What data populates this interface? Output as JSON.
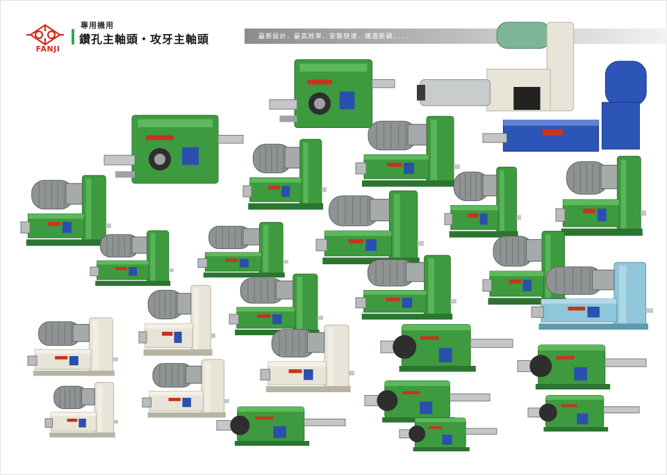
{
  "brand": {
    "logo_text": "FANJI"
  },
  "header": {
    "category": "專用機用",
    "title": "鑽孔主軸頭・攻牙主軸頭",
    "tagline": "最新設計．最高效率．安裝快速．構造新穎．．．．"
  },
  "colors": {
    "accent_green": "#2fa84f",
    "brand_red": "#d62a1e",
    "machine_green": "#3e9a3e",
    "machine_cream": "#e8e5d8",
    "machine_blue": "#2d55b8",
    "machine_lightblue": "#8fc6da",
    "motor_gray": "#8f9393"
  },
  "icons": {
    "logo": "fanji-logo-icon"
  },
  "products": [
    {
      "name": "twin-spindle-gearbox-head-large",
      "body": "green"
    },
    {
      "name": "twin-spindle-gearbox-head-top",
      "body": "green"
    },
    {
      "name": "servo-spindle-head",
      "body": "cream"
    },
    {
      "name": "blue-geared-feed-unit",
      "body": "blue"
    },
    {
      "name": "motor-drilling-head-left",
      "body": "green"
    },
    {
      "name": "motor-drilling-head-center-upper",
      "body": "green"
    },
    {
      "name": "motor-drilling-head-upper-right",
      "body": "green"
    },
    {
      "name": "motor-drilling-head-right-1",
      "body": "green"
    },
    {
      "name": "motor-drilling-head-right-2",
      "body": "green"
    },
    {
      "name": "motor-drilling-head-small-1",
      "body": "green"
    },
    {
      "name": "motor-drilling-head-mid-1",
      "body": "green"
    },
    {
      "name": "motor-drilling-head-mid-2",
      "body": "green"
    },
    {
      "name": "motor-drilling-head-mid-3",
      "body": "green"
    },
    {
      "name": "motor-drilling-head-mid-4",
      "body": "green"
    },
    {
      "name": "motor-drilling-head-right-3",
      "body": "green"
    },
    {
      "name": "lightblue-drilling-head",
      "body": "lightblue"
    },
    {
      "name": "cream-drilling-head-1",
      "body": "cream"
    },
    {
      "name": "cream-drilling-head-2",
      "body": "cream"
    },
    {
      "name": "cream-drilling-head-3",
      "body": "cream"
    },
    {
      "name": "cream-drilling-head-4",
      "body": "cream"
    },
    {
      "name": "cream-drilling-head-5",
      "body": "cream"
    },
    {
      "name": "green-spindle-unit-1",
      "body": "green"
    },
    {
      "name": "green-spindle-unit-2",
      "body": "green"
    },
    {
      "name": "green-spindle-unit-3",
      "body": "green"
    },
    {
      "name": "green-spindle-unit-4",
      "body": "green"
    },
    {
      "name": "green-spindle-unit-5",
      "body": "green"
    },
    {
      "name": "green-spindle-unit-6",
      "body": "green"
    }
  ]
}
